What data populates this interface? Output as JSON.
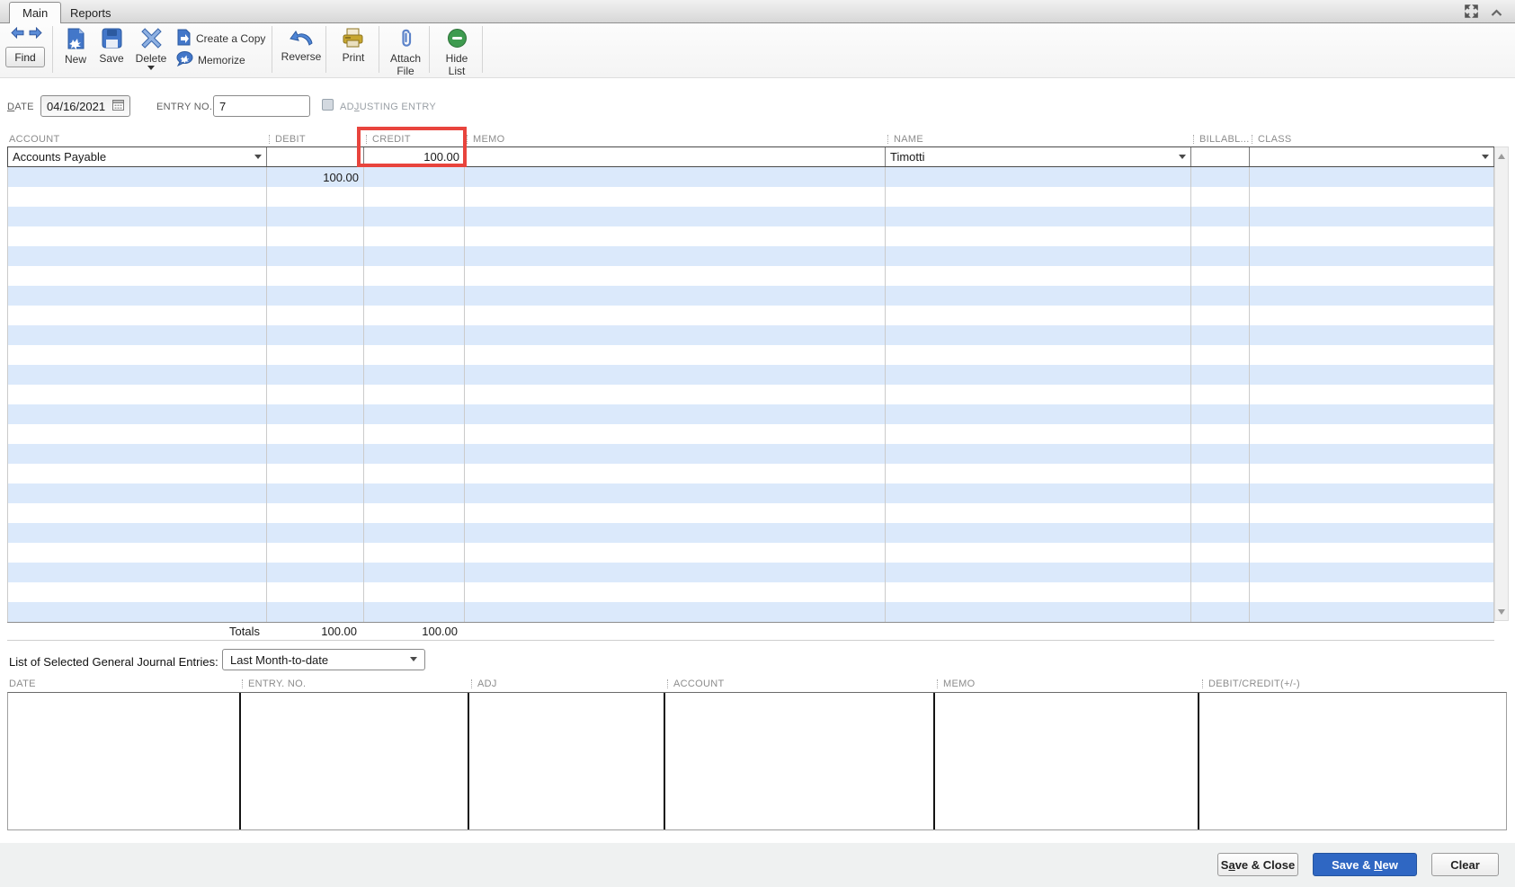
{
  "tabs": {
    "main": "Main",
    "reports": "Reports"
  },
  "toolbar": {
    "find": "Find",
    "new": "New",
    "save": "Save",
    "delete": "Delete",
    "create_a_copy": "Create a Copy",
    "memorize": "Memorize",
    "reverse": "Reverse",
    "print": "Print",
    "attach": {
      "line1": "Attach",
      "line2": "File"
    },
    "hide": {
      "line1": "Hide",
      "line2": "List"
    }
  },
  "form": {
    "date_label": {
      "u": "D",
      "post": "ATE"
    },
    "date_value": "04/16/2021",
    "entry_no_label": "ENTRY NO.",
    "entry_no_value": "7",
    "adjusting_label": {
      "pre": "AD",
      "u": "J",
      "post": "USTING ENTRY"
    }
  },
  "grid": {
    "headers": {
      "account": "ACCOUNT",
      "debit": "DEBIT",
      "credit": "CREDIT",
      "memo": "MEMO",
      "name": "NAME",
      "billable": "BILLABL...",
      "class": "CLASS"
    },
    "row1": {
      "account": "Accounts Payable",
      "credit": "100.00",
      "name": "Timotti"
    },
    "row2": {
      "debit": "100.00"
    },
    "totals": {
      "label": "Totals",
      "debit": "100.00",
      "credit": "100.00"
    }
  },
  "list_section": {
    "label": "List of Selected General Journal Entries:",
    "filter_value": "Last Month-to-date",
    "headers": {
      "date": "DATE",
      "entry_no": "ENTRY. NO.",
      "adj": "ADJ",
      "account": "ACCOUNT",
      "memo": "MEMO",
      "debit_credit": "DEBIT/CREDIT(+/-)"
    }
  },
  "footer": {
    "save_close": {
      "pre": "S",
      "u": "a",
      "post": "ve & Close"
    },
    "save_new": {
      "pre": "Save & ",
      "u": "N",
      "post": "ew"
    },
    "clear": "Clear"
  },
  "colors": {
    "highlight_red": "#e8443d",
    "primary_button_blue": "#2f67c3",
    "row_alt_blue": "#dbe9fb"
  }
}
